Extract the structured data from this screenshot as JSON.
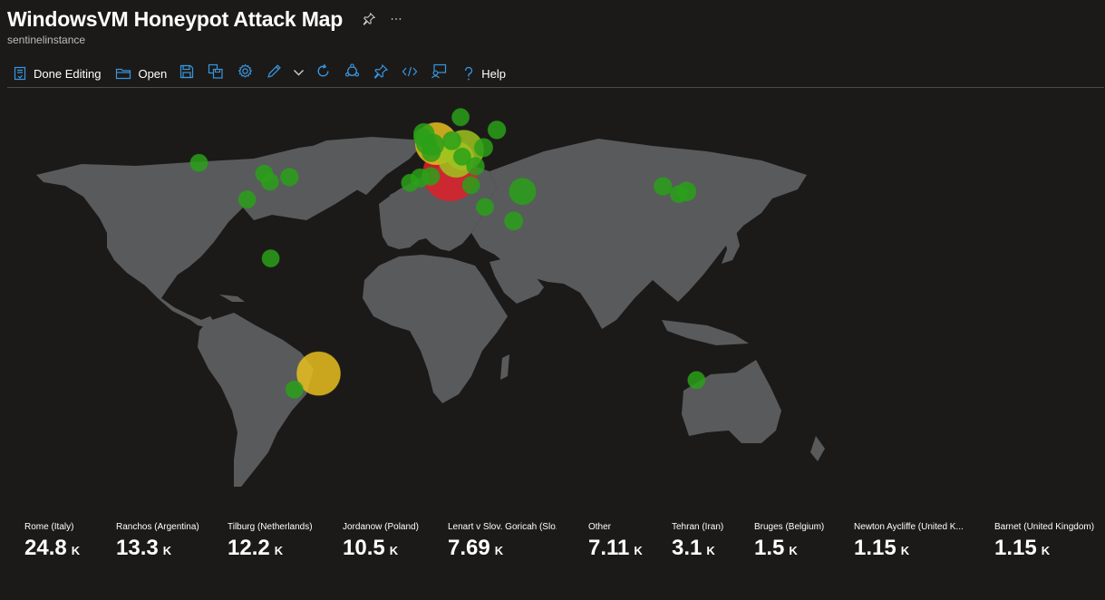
{
  "header": {
    "title": "WindowsVM Honeypot Attack Map",
    "subtitle": "sentinelinstance",
    "pin_icon": "pin-icon",
    "more_icon": "ellipsis-icon"
  },
  "toolbar": {
    "done_editing_label": "Done Editing",
    "open_label": "Open",
    "help_label": "Help",
    "icons": [
      "edit-doc-icon",
      "folder-icon",
      "save-icon",
      "save-as-icon",
      "settings-icon",
      "pencil-icon",
      "chevron-down-icon",
      "refresh-icon",
      "workbook-icon",
      "pin-icon",
      "code-icon",
      "feedback-icon",
      "help-icon"
    ]
  },
  "colors": {
    "background": "#1b1a19",
    "land": "#595a5c",
    "accent": "#3a96dd",
    "marker_low": "#2aa019",
    "marker_mid": "#9fc31e",
    "marker_high": "#e8c01e",
    "marker_top": "#e0202a"
  },
  "tiles": [
    {
      "label": "Rome (Italy)",
      "value": "24.8",
      "unit": "K"
    },
    {
      "label": "Ranchos (Argentina)",
      "value": "13.3",
      "unit": "K"
    },
    {
      "label": "Tilburg (Netherlands)",
      "value": "12.2",
      "unit": "K"
    },
    {
      "label": "Jordanow (Poland)",
      "value": "10.5",
      "unit": "K"
    },
    {
      "label": "Lenart v Slov. Goricah (Slo...",
      "value": "7.69",
      "unit": "K"
    },
    {
      "label": "Other",
      "value": "7.11",
      "unit": "K"
    },
    {
      "label": "Tehran (Iran)",
      "value": "3.1",
      "unit": "K"
    },
    {
      "label": "Bruges (Belgium)",
      "value": "1.5",
      "unit": "K"
    },
    {
      "label": "Newton Aycliffe (United K...",
      "value": "1.15",
      "unit": "K"
    },
    {
      "label": "Barnet (United Kingdom)",
      "value": "1.15",
      "unit": "K"
    }
  ],
  "map_markers": [
    {
      "place": "Rome (Italy)",
      "lat": 41.9,
      "lon": 12.5,
      "count": 24800,
      "color": "#e0202a"
    },
    {
      "place": "Ranchos (Argentina)",
      "lat": -35.5,
      "lon": -58.3,
      "count": 13300,
      "color": "#e8c01e"
    },
    {
      "place": "Tilburg (Netherlands)",
      "lat": 51.6,
      "lon": 5.1,
      "count": 12200,
      "color": "#e8c01e"
    },
    {
      "place": "Jordanow (Poland)",
      "lat": 49.6,
      "lon": 19.8,
      "count": 10500,
      "color": "#9fc31e"
    },
    {
      "place": "Lenart v Slov. Goricah (Slo...",
      "lat": 46.6,
      "lon": 15.8,
      "count": 7690,
      "color": "#9fc31e"
    },
    {
      "place": "Tehran (Iran)",
      "lat": 35.7,
      "lon": 51.4,
      "count": 3100,
      "color": "#2aa019"
    },
    {
      "place": "Bruges (Belgium)",
      "lat": 51.2,
      "lon": 3.2,
      "count": 1500,
      "color": "#2aa019"
    },
    {
      "place": "Newton Aycliffe (United K...",
      "lat": 54.6,
      "lon": -1.6,
      "count": 1150,
      "color": "#2aa019"
    },
    {
      "place": "Barnet (United Kingdom)",
      "lat": 51.6,
      "lon": -0.2,
      "count": 1150,
      "color": "#2aa019"
    },
    {
      "place": "",
      "lat": 52.5,
      "lon": 13.4,
      "count": 700,
      "color": "#2aa019"
    },
    {
      "place": "",
      "lat": 59.3,
      "lon": 18.1,
      "count": 500,
      "color": "#2aa019"
    },
    {
      "place": "",
      "lat": 55.7,
      "lon": 37.6,
      "count": 600,
      "color": "#2aa019"
    },
    {
      "place": "",
      "lat": 50.4,
      "lon": 30.5,
      "count": 700,
      "color": "#2aa019"
    },
    {
      "place": "",
      "lat": 53.5,
      "lon": -2.3,
      "count": 600,
      "color": "#2aa019"
    },
    {
      "place": "",
      "lat": 48.8,
      "lon": 2.3,
      "count": 700,
      "color": "#2aa019"
    },
    {
      "place": "",
      "lat": 47.5,
      "lon": 19.0,
      "count": 500,
      "color": "#2aa019"
    },
    {
      "place": "",
      "lat": 44.4,
      "lon": 26.1,
      "count": 600,
      "color": "#2aa019"
    },
    {
      "place": "",
      "lat": 40.4,
      "lon": -3.7,
      "count": 700,
      "color": "#2aa019"
    },
    {
      "place": "",
      "lat": 38.7,
      "lon": -9.1,
      "count": 500,
      "color": "#2aa019"
    },
    {
      "place": "",
      "lat": 41.0,
      "lon": 2.0,
      "count": 600,
      "color": "#2aa019"
    },
    {
      "place": "",
      "lat": 37.9,
      "lon": 23.7,
      "count": 500,
      "color": "#2aa019"
    },
    {
      "place": "",
      "lat": 30.0,
      "lon": 31.2,
      "count": 500,
      "color": "#2aa019"
    },
    {
      "place": "",
      "lat": 24.7,
      "lon": 46.7,
      "count": 700,
      "color": "#2aa019"
    },
    {
      "place": "",
      "lat": 37.5,
      "lon": 127.0,
      "count": 600,
      "color": "#2aa019"
    },
    {
      "place": "",
      "lat": 35.7,
      "lon": 139.7,
      "count": 800,
      "color": "#2aa019"
    },
    {
      "place": "",
      "lat": 34.7,
      "lon": 135.5,
      "count": 500,
      "color": "#2aa019"
    },
    {
      "place": "",
      "lat": 45.5,
      "lon": -122.7,
      "count": 500,
      "color": "#2aa019"
    },
    {
      "place": "",
      "lat": 41.9,
      "lon": -87.6,
      "count": 500,
      "color": "#2aa019"
    },
    {
      "place": "",
      "lat": 40.7,
      "lon": -74.0,
      "count": 600,
      "color": "#2aa019"
    },
    {
      "place": "",
      "lat": 32.8,
      "lon": -96.8,
      "count": 500,
      "color": "#2aa019"
    },
    {
      "place": "",
      "lat": 39.1,
      "lon": -84.5,
      "count": 500,
      "color": "#2aa019"
    },
    {
      "place": "",
      "lat": 9.9,
      "lon": -84.1,
      "count": 500,
      "color": "#2aa019"
    },
    {
      "place": "",
      "lat": -41.1,
      "lon": -71.3,
      "count": 500,
      "color": "#2aa019"
    },
    {
      "place": "",
      "lat": -37.8,
      "lon": 145.0,
      "count": 500,
      "color": "#2aa019"
    }
  ]
}
